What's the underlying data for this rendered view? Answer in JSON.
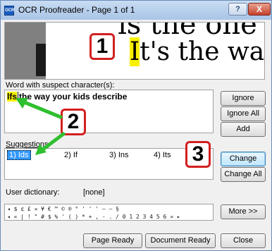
{
  "window": {
    "app_icon_text": "OCR",
    "title": "OCR Proofreader - Page 1 of 1",
    "help_label": "?",
    "close_label": "X"
  },
  "preview": {
    "top_line": "is the one yo",
    "main_highlight": "I",
    "main_rest": "t's the way yo"
  },
  "word": {
    "label": "Word with suspect character(s):",
    "suspect": "lfs",
    "rest": "the way your kids describe"
  },
  "suggestions": {
    "label": "Suggestions",
    "items": [
      "1) Ids",
      "2) If",
      "3) Ins",
      "4) Its"
    ],
    "selected_index": 0
  },
  "dictionary": {
    "label": "User dictionary:",
    "value": "[none]"
  },
  "characters": {
    "row1": "◂ $ ¢ £ ¤ ¥ € ™ © ® ° ' ' ' — – § ",
    "row2": "◂ « | ! \" # $ % ' ( ) * + , - . / 0 1 2 3 4 5 6 » ▸"
  },
  "buttons": {
    "ignore": "Ignore",
    "ignore_all": "Ignore All",
    "add": "Add",
    "change": "Change",
    "change_all": "Change All",
    "more": "More >>",
    "page_ready": "Page Ready",
    "document_ready": "Document Ready",
    "close": "Close"
  },
  "annotations": {
    "callout_1": "1",
    "callout_2": "2",
    "callout_3": "3",
    "callout_color": "#d22020",
    "arrow_color": "#2fbf2f"
  },
  "colors": {
    "highlight": "#f7f000",
    "selection": "#3399ff"
  }
}
